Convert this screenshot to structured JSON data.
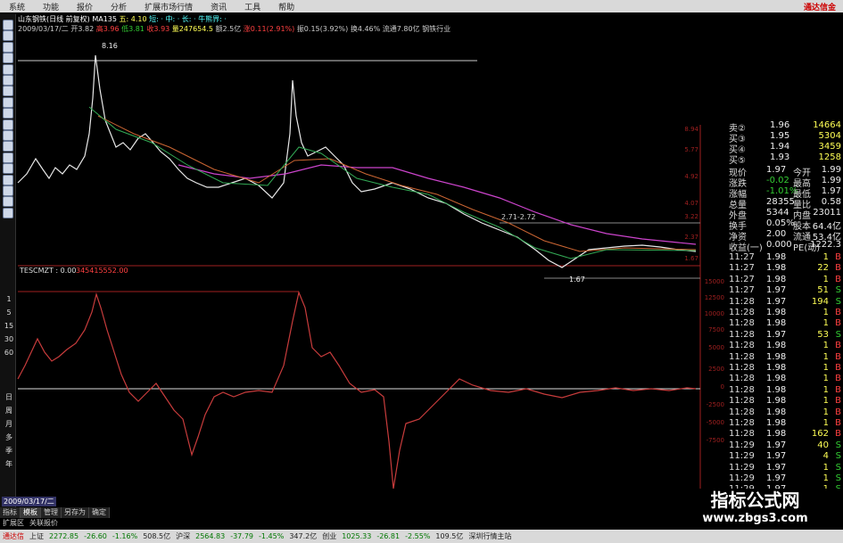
{
  "menu": {
    "items": [
      "系统",
      "功能",
      "报价",
      "分析",
      "扩展市场行情",
      "资讯",
      "工具",
      "帮助"
    ],
    "brand": "通达信金"
  },
  "header": {
    "line1": {
      "name": "山东钢铁(日线 前复权)",
      "ma": "MA135",
      "wu": "五: 4.10",
      "legend": "短: · 中: · 长: · 牛熊界: ·"
    },
    "line2": {
      "date": "2009/03/17/二",
      "open": "开3.82",
      "high": "高3.96",
      "low": "低3.81",
      "close": "收3.93",
      "volume": "量247654.5",
      "amount": "额2.5亿",
      "change": "涨0.11(2.91%)",
      "amplitude": "振0.15(3.92%)",
      "turnover": "换4.46%",
      "float": "流通7.80亿",
      "sector": "钢铁行业"
    },
    "peak_label": "8.16",
    "low_label": "1.67",
    "range_label": "2.71-2.72"
  },
  "price_axis": [
    "8.94",
    "5.77",
    "4.92",
    "4.07",
    "3.22",
    "2.37",
    "1.67"
  ],
  "indicator": {
    "name": "TESCMZT",
    "value": "0.00",
    "extra": "345415552.00",
    "axis_left": [
      "1",
      "5",
      "15",
      "30",
      "60"
    ],
    "axis_right": [
      "15000",
      "12500",
      "10000",
      "7500",
      "5000",
      "2500",
      "0",
      "-2500",
      "-5000",
      "-7500"
    ],
    "left_period": [
      "日",
      "周",
      "月",
      "多",
      "季",
      "年"
    ]
  },
  "quotes": [
    {
      "label": "卖②",
      "price": "1.96",
      "vol": "14664"
    },
    {
      "label": "买③",
      "price": "1.95",
      "vol": "5304"
    },
    {
      "label": "买④",
      "price": "1.94",
      "vol": "3459"
    },
    {
      "label": "买⑤",
      "price": "1.93",
      "vol": "1258"
    }
  ],
  "stats": [
    {
      "k1": "现价",
      "v1": "1.97",
      "k2": "今开",
      "v2": "1.99"
    },
    {
      "k1": "涨跌",
      "v1": "-0.02",
      "k2": "最高",
      "v2": "1.99"
    },
    {
      "k1": "涨幅",
      "v1": "-1.01%",
      "k2": "最低",
      "v2": "1.97"
    },
    {
      "k1": "总量",
      "v1": "28355",
      "k2": "量比",
      "v2": "0.58"
    },
    {
      "k1": "外盘",
      "v1": "5344",
      "k2": "内盘",
      "v2": "23011"
    },
    {
      "k1": "换手",
      "v1": "0.05%",
      "k2": "股本",
      "v2": "64.4亿"
    },
    {
      "k1": "净资",
      "v1": "2.00",
      "k2": "流通",
      "v2": "53.4亿"
    },
    {
      "k1": "收益(一)",
      "v1": "0.000",
      "k2": "PE(动)",
      "v2": "1222.3"
    }
  ],
  "ticks": [
    {
      "t": "11:27",
      "p": "1.98",
      "v": "1",
      "d": "B"
    },
    {
      "t": "11:27",
      "p": "1.98",
      "v": "22",
      "d": "B"
    },
    {
      "t": "11:27",
      "p": "1.98",
      "v": "1",
      "d": "B"
    },
    {
      "t": "11:27",
      "p": "1.97",
      "v": "51",
      "d": "S"
    },
    {
      "t": "11:28",
      "p": "1.97",
      "v": "194",
      "d": "S"
    },
    {
      "t": "11:28",
      "p": "1.98",
      "v": "1",
      "d": "B"
    },
    {
      "t": "11:28",
      "p": "1.98",
      "v": "1",
      "d": "B"
    },
    {
      "t": "11:28",
      "p": "1.97",
      "v": "53",
      "d": "S"
    },
    {
      "t": "11:28",
      "p": "1.98",
      "v": "1",
      "d": "B"
    },
    {
      "t": "11:28",
      "p": "1.98",
      "v": "1",
      "d": "B"
    },
    {
      "t": "11:28",
      "p": "1.98",
      "v": "1",
      "d": "B"
    },
    {
      "t": "11:28",
      "p": "1.98",
      "v": "1",
      "d": "B"
    },
    {
      "t": "11:28",
      "p": "1.98",
      "v": "1",
      "d": "B"
    },
    {
      "t": "11:28",
      "p": "1.98",
      "v": "1",
      "d": "B"
    },
    {
      "t": "11:28",
      "p": "1.98",
      "v": "1",
      "d": "B"
    },
    {
      "t": "11:28",
      "p": "1.98",
      "v": "1",
      "d": "B"
    },
    {
      "t": "11:28",
      "p": "1.98",
      "v": "162",
      "d": "B"
    },
    {
      "t": "11:29",
      "p": "1.97",
      "v": "40",
      "d": "S"
    },
    {
      "t": "11:29",
      "p": "1.97",
      "v": "4",
      "d": "S"
    },
    {
      "t": "11:29",
      "p": "1.97",
      "v": "1",
      "d": "S"
    },
    {
      "t": "11:29",
      "p": "1.97",
      "v": "1",
      "d": "S"
    },
    {
      "t": "11:29",
      "p": "1.97",
      "v": "1",
      "d": "S"
    },
    {
      "t": "11:29",
      "p": "1.97",
      "v": "1",
      "d": "S"
    }
  ],
  "bottom": {
    "cursor_date": "2009/03/17/二",
    "tabs": [
      "指标",
      "模板",
      "管理",
      "另存为",
      "确定"
    ],
    "subtabs": [
      "扩展区",
      "关联报价"
    ],
    "status": [
      {
        "label": "通达信",
        "cls": "r"
      },
      {
        "label": "上证",
        "cls": ""
      },
      {
        "label": "2272.85",
        "cls": "g"
      },
      {
        "label": "-26.60",
        "cls": "g"
      },
      {
        "label": "-1.16%",
        "cls": "g"
      },
      {
        "label": "508.5亿",
        "cls": ""
      },
      {
        "label": "沪深",
        "cls": ""
      },
      {
        "label": "2564.83",
        "cls": "g"
      },
      {
        "label": "-37.79",
        "cls": "g"
      },
      {
        "label": "-1.45%",
        "cls": "g"
      },
      {
        "label": "347.2亿",
        "cls": ""
      },
      {
        "label": "创业",
        "cls": ""
      },
      {
        "label": "1025.33",
        "cls": "g"
      },
      {
        "label": "-26.81",
        "cls": "g"
      },
      {
        "label": "-2.55%",
        "cls": "g"
      },
      {
        "label": "109.5亿",
        "cls": ""
      },
      {
        "label": "深圳行情主站",
        "cls": ""
      }
    ]
  },
  "watermark": {
    "title": "指标公式网",
    "url": "www.zbgs3.com"
  },
  "colors": {
    "price_line": "#e8e8e8",
    "ma_long": "#cc44cc",
    "ma_mid": "#cc6633",
    "ma_short": "#33aa55",
    "indicator": "#c83c3c",
    "axis_red": "#a02020"
  }
}
